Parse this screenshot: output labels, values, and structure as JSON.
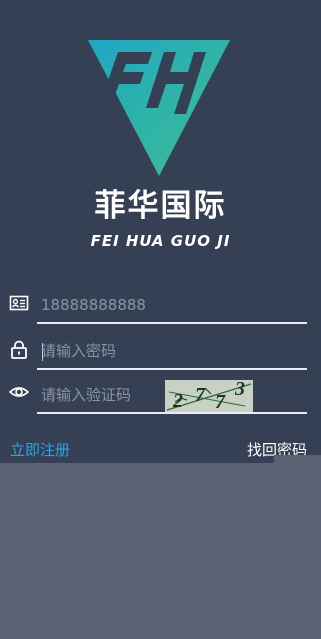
{
  "brand": {
    "name_cn": "菲华国际",
    "name_en": "FEI HUA GUO JI"
  },
  "form": {
    "phone": {
      "icon": "id-card-icon",
      "value": "18888888888",
      "placeholder": ""
    },
    "password": {
      "icon": "lock-icon",
      "value": "",
      "placeholder": "请输入密码"
    },
    "captcha": {
      "icon": "eye-icon",
      "value": "",
      "placeholder": "请输入验证码",
      "image_text": "2773"
    }
  },
  "links": {
    "register": "立即注册",
    "forgot_password": "找回密码"
  },
  "colors": {
    "background": "#364054",
    "lower_background": "#5a6172",
    "accent": "#2aa6e0",
    "logo_teal": "#1fa6c4",
    "logo_green": "#3fc08f"
  }
}
